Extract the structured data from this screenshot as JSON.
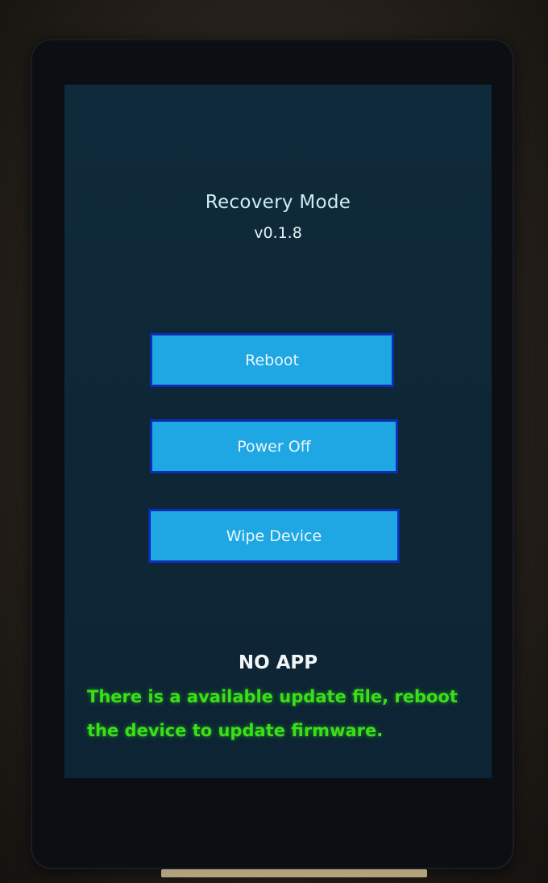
{
  "screen": {
    "title": "Recovery Mode",
    "version": "v0.1.8",
    "buttons": {
      "reboot": "Reboot",
      "power_off": "Power Off",
      "wipe_device": "Wipe Device"
    },
    "status": "NO APP",
    "update_message": "There is a available update file, reboot the device to update firmware."
  },
  "colors": {
    "screen_background": "#0f2a3a",
    "button_fill": "#1fa7e3",
    "button_border": "#0b2db8",
    "update_text": "#39e018"
  }
}
